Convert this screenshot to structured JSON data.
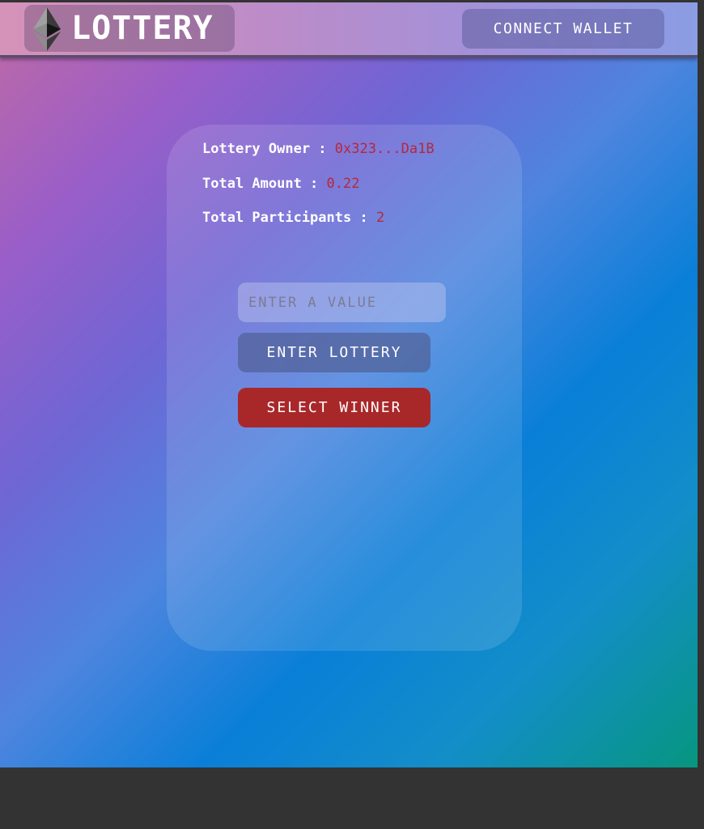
{
  "header": {
    "logo_icon": "ethereum-icon",
    "title": "LOTTERY",
    "connect_label": "CONNECT WALLET"
  },
  "card": {
    "owner": {
      "label": "Lottery Owner : ",
      "value": "0x323...Da1B"
    },
    "amount": {
      "label": "Total Amount : ",
      "value": "0.22"
    },
    "participants": {
      "label": "Total Participants : ",
      "value": "2"
    },
    "input": {
      "placeholder": "ENTER A VALUE",
      "value": ""
    },
    "enter_label": "ENTER LOTTERY",
    "winner_label": "SELECT WINNER"
  },
  "colors": {
    "accent_value": "#b5283a",
    "winner_button": "#a8282a"
  }
}
